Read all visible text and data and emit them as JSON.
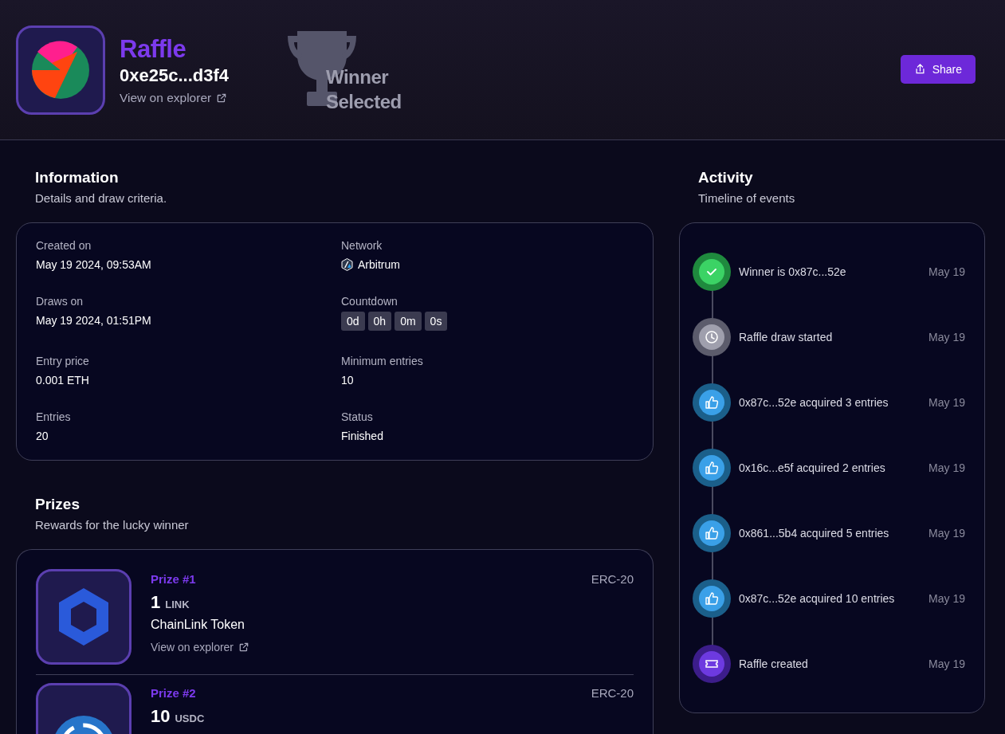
{
  "header": {
    "title": "Raffle",
    "address": "0xe25c...d3f4",
    "explorer_link": "View on explorer",
    "badge": [
      "Winner",
      "Selected"
    ],
    "share_button": "Share"
  },
  "information": {
    "title": "Information",
    "subtitle": "Details and draw criteria.",
    "fields": [
      {
        "label": "Created on",
        "value": "May 19 2024, 09:53AM",
        "kind": "text"
      },
      {
        "label": "Network",
        "value": "Arbitrum",
        "kind": "network"
      },
      {
        "label": "Draws on",
        "value": "May 19 2024, 01:51PM",
        "kind": "text"
      },
      {
        "label": "Countdown",
        "parts": [
          "0d",
          "0h",
          "0m",
          "0s"
        ],
        "kind": "countdown"
      },
      {
        "label": "Entry price",
        "value": "0.001 ETH",
        "kind": "text"
      },
      {
        "label": "Minimum entries",
        "value": "10",
        "kind": "text"
      },
      {
        "label": "Entries",
        "value": "20",
        "kind": "text"
      },
      {
        "label": "Status",
        "value": "Finished",
        "kind": "text"
      }
    ]
  },
  "prizes": {
    "title": "Prizes",
    "subtitle": "Rewards for the lucky winner",
    "items": [
      {
        "label": "Prize #1",
        "standard": "ERC-20",
        "amount": "1",
        "unit": "LINK",
        "name": "ChainLink Token",
        "explorer_link": "View on explorer",
        "kind": "link"
      },
      {
        "label": "Prize #2",
        "standard": "ERC-20",
        "amount": "10",
        "unit": "USDC",
        "kind": "usdc"
      }
    ]
  },
  "activity": {
    "title": "Activity",
    "subtitle": "Timeline of events",
    "events": [
      {
        "kind": "winner",
        "text": "Winner is 0x87c...52e",
        "date": "May 19"
      },
      {
        "kind": "draw",
        "text": "Raffle draw started",
        "date": "May 19"
      },
      {
        "kind": "entry",
        "text": "0x87c...52e acquired 3 entries",
        "date": "May 19"
      },
      {
        "kind": "entry",
        "text": "0x16c...e5f acquired 2 entries",
        "date": "May 19"
      },
      {
        "kind": "entry",
        "text": "0x861...5b4 acquired 5 entries",
        "date": "May 19"
      },
      {
        "kind": "entry",
        "text": "0x87c...52e acquired 10 entries",
        "date": "May 19"
      },
      {
        "kind": "created",
        "text": "Raffle created",
        "date": "May 19"
      }
    ]
  }
}
